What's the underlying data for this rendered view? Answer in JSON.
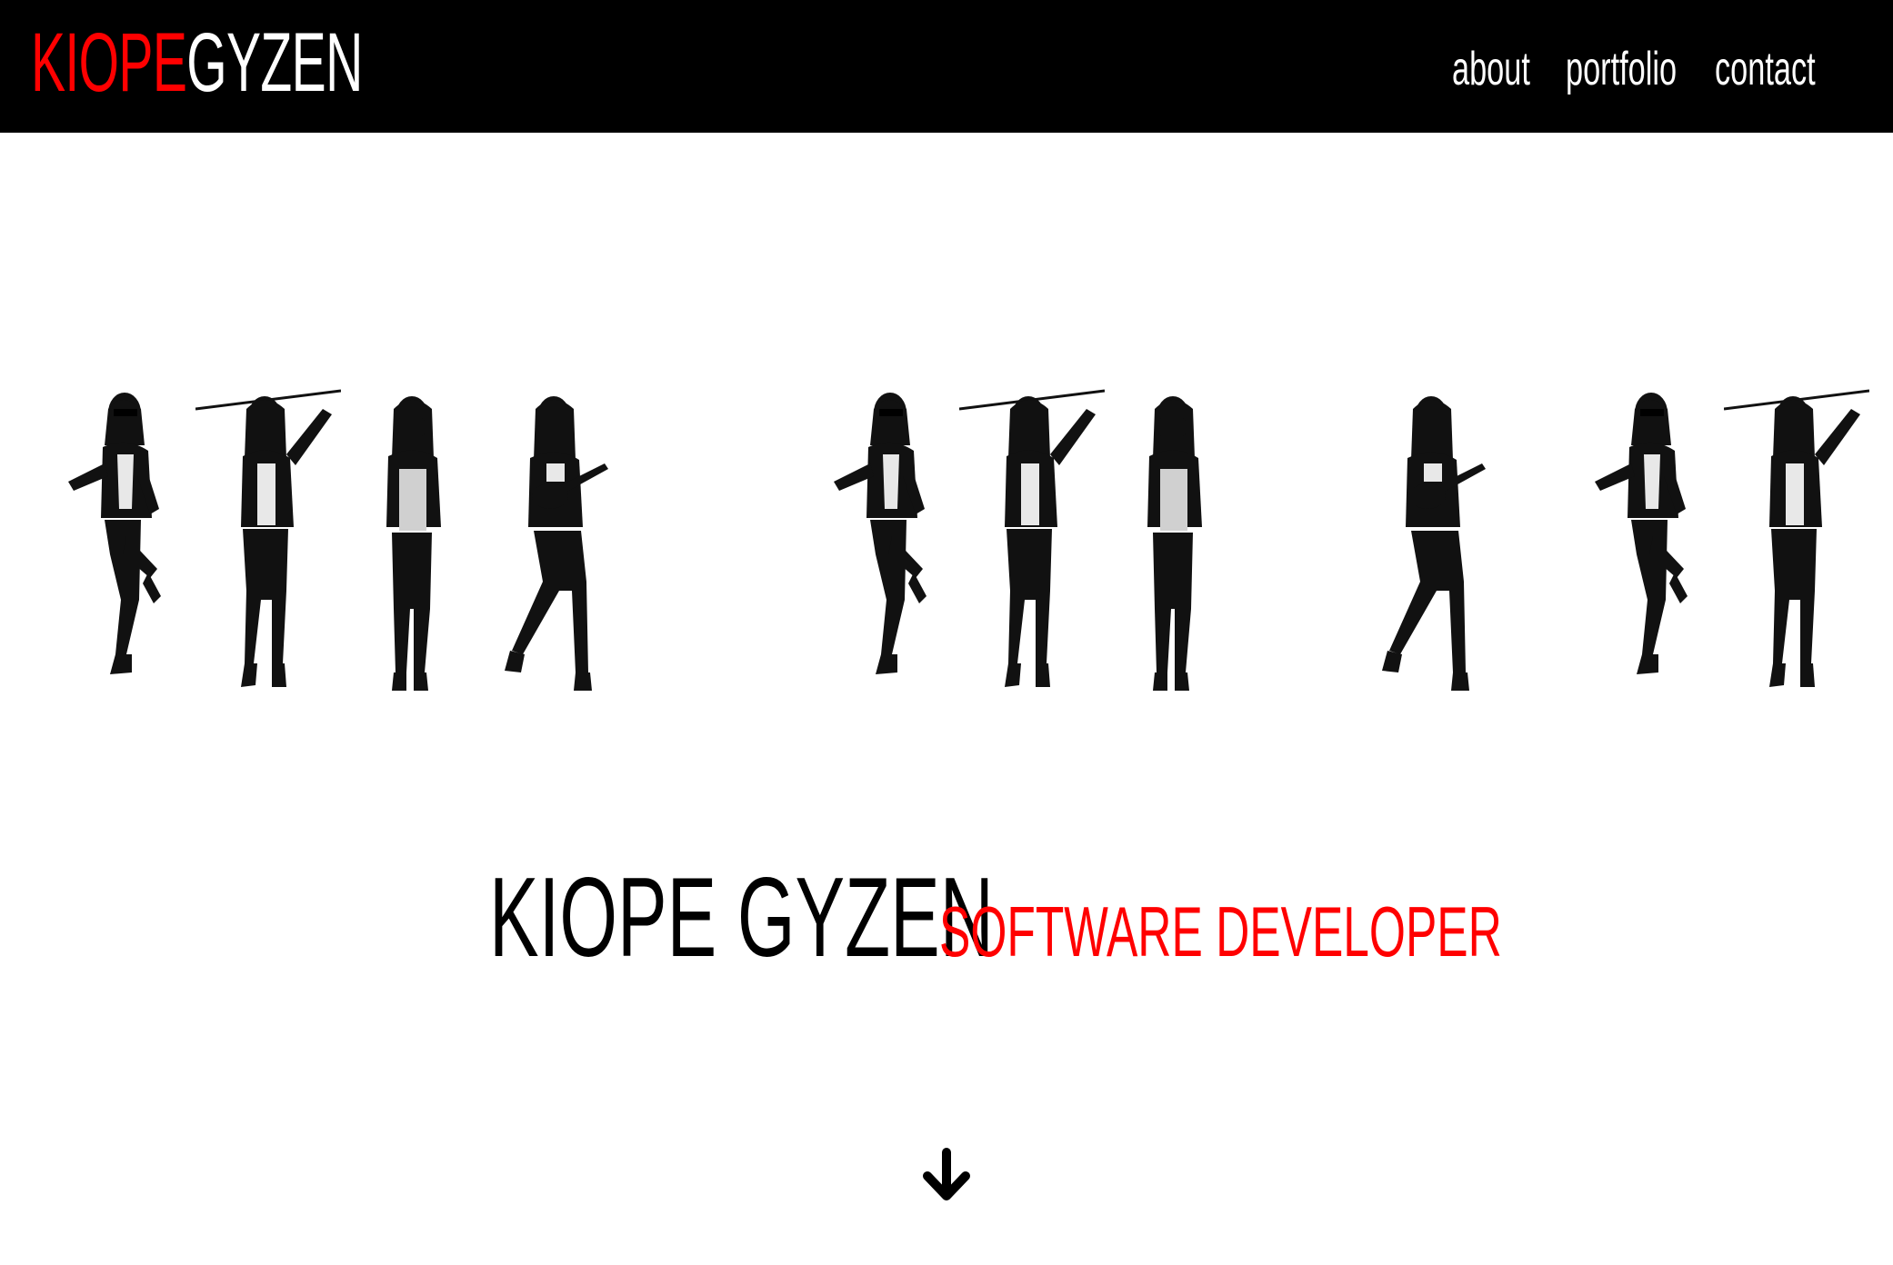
{
  "header": {
    "logo_first": "KIOPE",
    "logo_last": "GYZEN",
    "nav": {
      "about": "about",
      "portfolio": "portfolio",
      "contact": "contact"
    }
  },
  "hero": {
    "name": "KIOPE GYZEN",
    "role": "SOFTWARE DEVELOPER"
  },
  "figures": [
    "sunglasses-pose",
    "golf-swing-pose",
    "camera-pose",
    "ukulele-pose",
    "sunglasses-pose",
    "golf-swing-pose",
    "camera-pose",
    "ukulele-pose",
    "sunglasses-pose",
    "golf-swing-pose"
  ],
  "icons": {
    "scroll": "arrow-down-icon"
  },
  "colors": {
    "accent": "#ff0000",
    "header_bg": "#000000",
    "page_bg": "#ffffff"
  }
}
